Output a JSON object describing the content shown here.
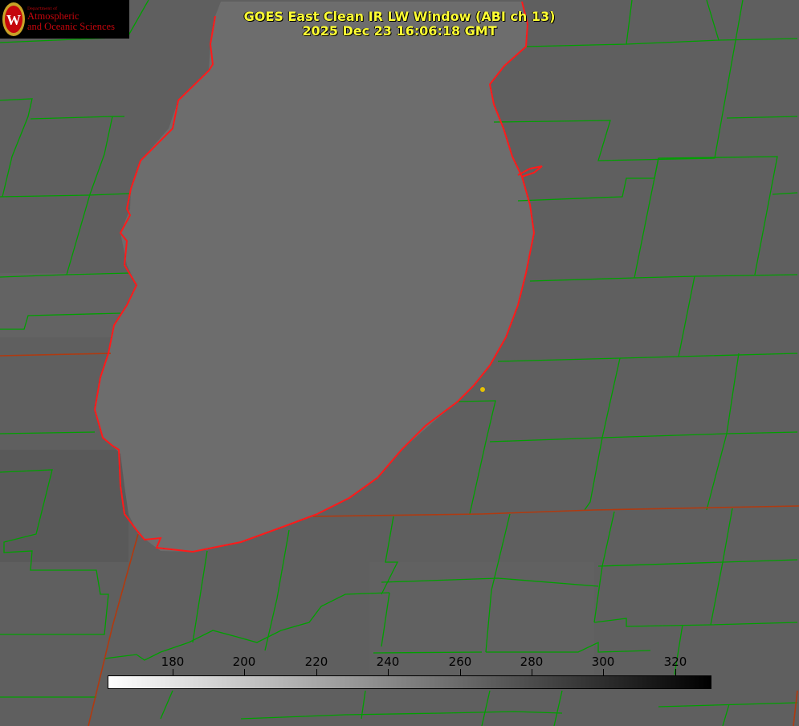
{
  "title": {
    "line1": "GOES East Clean IR LW Window (ABI ch 13)",
    "line2": "2025 Dec 23 16:06:18 GMT"
  },
  "logo": {
    "department": "Department of",
    "line1": "Atmospheric",
    "line2": "and Oceanic Sciences"
  },
  "colorbar": {
    "ticks": [
      "180",
      "200",
      "220",
      "240",
      "260",
      "280",
      "300",
      "320"
    ],
    "colors": {
      "low": "#ffffff",
      "high": "#000000"
    }
  },
  "colors": {
    "background": "#5d5d5d",
    "lake": "#6e6e6e",
    "county_lines": "#00a000",
    "coastline": "#ff1a1a",
    "state_lines": "#b03a10",
    "marker": "#e6c200",
    "title_text": "#ffff33"
  }
}
